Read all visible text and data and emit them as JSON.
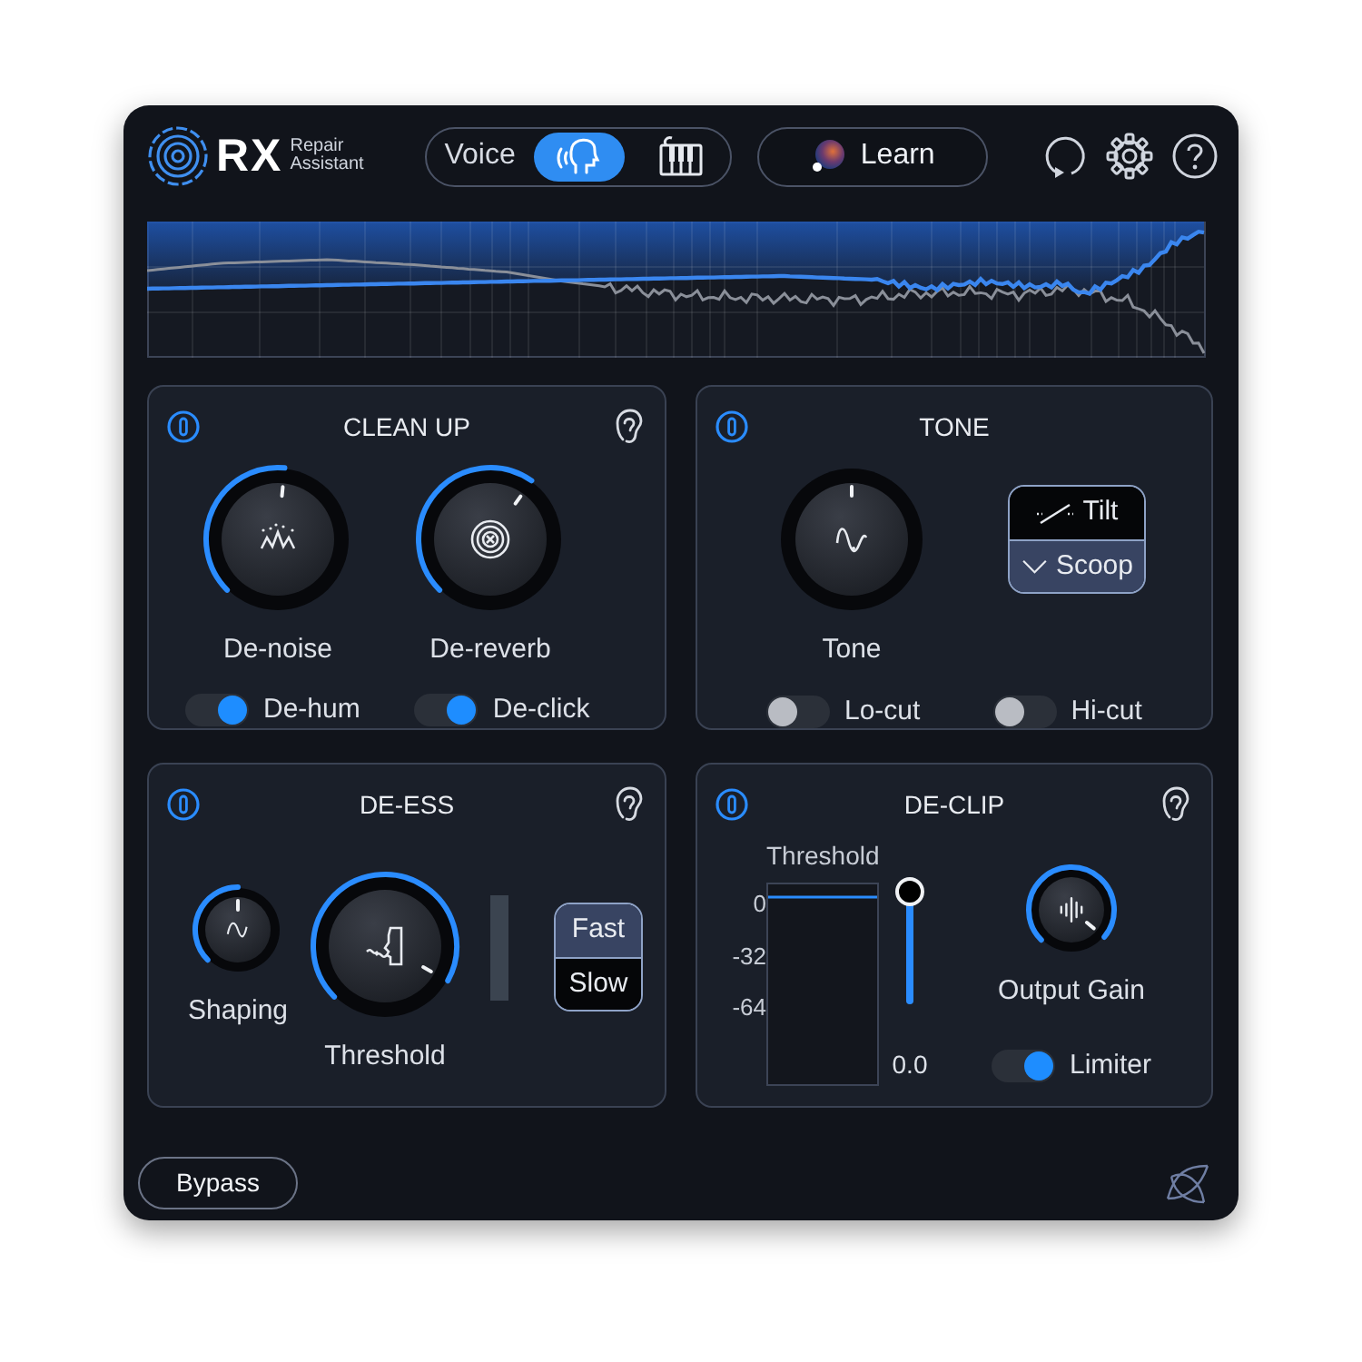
{
  "header": {
    "logo": "RX",
    "subtitle": "Repair Assistant",
    "mode_label": "Voice",
    "modes": [
      {
        "kind": "voice",
        "selected": true
      },
      {
        "kind": "instrument",
        "selected": false
      }
    ],
    "learn_button": "Learn"
  },
  "panels": [
    {
      "kind": "cleanup",
      "title": "CLEAN UP",
      "enabled": true,
      "listen": true,
      "knobs": [
        {
          "label": "De-noise",
          "kind": "large"
        },
        {
          "label": "De-reverb",
          "kind": "large"
        }
      ],
      "toggles": [
        {
          "label": "De-hum",
          "on": true
        },
        {
          "label": "De-click",
          "on": true
        }
      ]
    },
    {
      "kind": "tone",
      "title": "TONE",
      "enabled": true,
      "listen": false,
      "knobs": [
        {
          "label": "Tone",
          "kind": "center"
        }
      ],
      "modes": [
        {
          "label": "Tilt",
          "selected": false
        },
        {
          "label": "Scoop",
          "selected": true
        }
      ],
      "toggles": [
        {
          "label": "Lo-cut",
          "on": false
        },
        {
          "label": "Hi-cut",
          "on": false
        }
      ]
    },
    {
      "kind": "deess",
      "title": "DE-ESS",
      "enabled": true,
      "listen": true,
      "knobs": [
        {
          "label": "Shaping",
          "kind": "small"
        },
        {
          "label": "Threshold",
          "kind": "large"
        }
      ],
      "modes": [
        {
          "label": "Fast",
          "selected": true
        },
        {
          "label": "Slow",
          "selected": false
        }
      ]
    },
    {
      "kind": "declip",
      "title": "DE-CLIP",
      "enabled": true,
      "listen": true,
      "threshold": {
        "label": "Threshold",
        "scale": [
          "0",
          "-32",
          "-64"
        ],
        "level": 1,
        "value": "0.0"
      },
      "knobs": [
        {
          "label": "Output Gain",
          "kind": "small"
        }
      ],
      "toggles": [
        {
          "label": "Limiter",
          "on": true
        }
      ]
    }
  ],
  "footer": {
    "bypass_button": "Bypass"
  }
}
